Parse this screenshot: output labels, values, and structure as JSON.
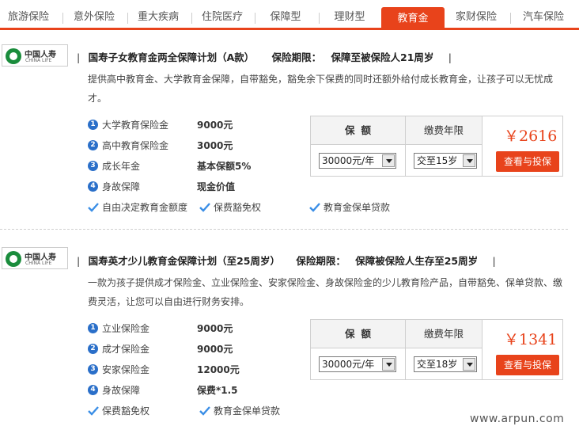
{
  "nav": {
    "items": [
      "旅游保险",
      "意外保险",
      "重大疾病",
      "住院医疗",
      "保障型",
      "理财型",
      "教育金",
      "家财保险",
      "汽车保险"
    ],
    "active_index": 6
  },
  "logo": {
    "cn": "中国人寿",
    "en": "CHINA LIFE"
  },
  "products": [
    {
      "name": "国寿子女教育金两全保障计划（A款）",
      "period_label": "保险期限：",
      "period_value": "保障至被保险人21周岁",
      "title_sep": "|",
      "description": "提供高中教育金、大学教育金保障，自带豁免，豁免余下保费的同时还额外给付成长教育金，让孩子可以无忧成才。",
      "features": [
        {
          "num": "1",
          "label": "大学教育保险金",
          "value": "9000元"
        },
        {
          "num": "2",
          "label": "高中教育保险金",
          "value": "3000元"
        },
        {
          "num": "3",
          "label": "成长年金",
          "value": "基本保额5%"
        },
        {
          "num": "4",
          "label": "身故保障",
          "value": "现金价值"
        }
      ],
      "perks": [
        "自由决定教育金额度",
        "保费豁免权",
        "教育金保单贷款"
      ],
      "coverage_header": "保额",
      "term_header": "缴费年限",
      "coverage_value": "30000元/年",
      "term_value": "交至15岁",
      "price": "￥2616",
      "button": "查看与投保"
    },
    {
      "name": "国寿英才少儿教育金保障计划（至25周岁）",
      "period_label": "保险期限：",
      "period_value": "保障被保险人生存至25周岁",
      "title_sep": "|",
      "description": "一款为孩子提供成才保险金、立业保险金、安家保险金、身故保险金的少儿教育险产品，自带豁免、保单贷款、缴费灵活，让您可以自由进行财务安排。",
      "features": [
        {
          "num": "1",
          "label": "立业保险金",
          "value": "9000元"
        },
        {
          "num": "2",
          "label": "成才保险金",
          "value": "9000元"
        },
        {
          "num": "3",
          "label": "安家保险金",
          "value": "12000元"
        },
        {
          "num": "4",
          "label": "身故保障",
          "value": "保费*1.5"
        }
      ],
      "perks": [
        "保费豁免权",
        "教育金保单贷款"
      ],
      "coverage_header": "保额",
      "term_header": "缴费年限",
      "coverage_value": "30000元/年",
      "term_value": "交至18岁",
      "price": "￥1341",
      "button": "查看与投保"
    }
  ],
  "watermark": "www.arpun.com",
  "colors": {
    "accent": "#e8431b",
    "icon_blue": "#2a6fc9",
    "logo_green": "#1a8c3c",
    "check_blue": "#3a8ee6"
  }
}
